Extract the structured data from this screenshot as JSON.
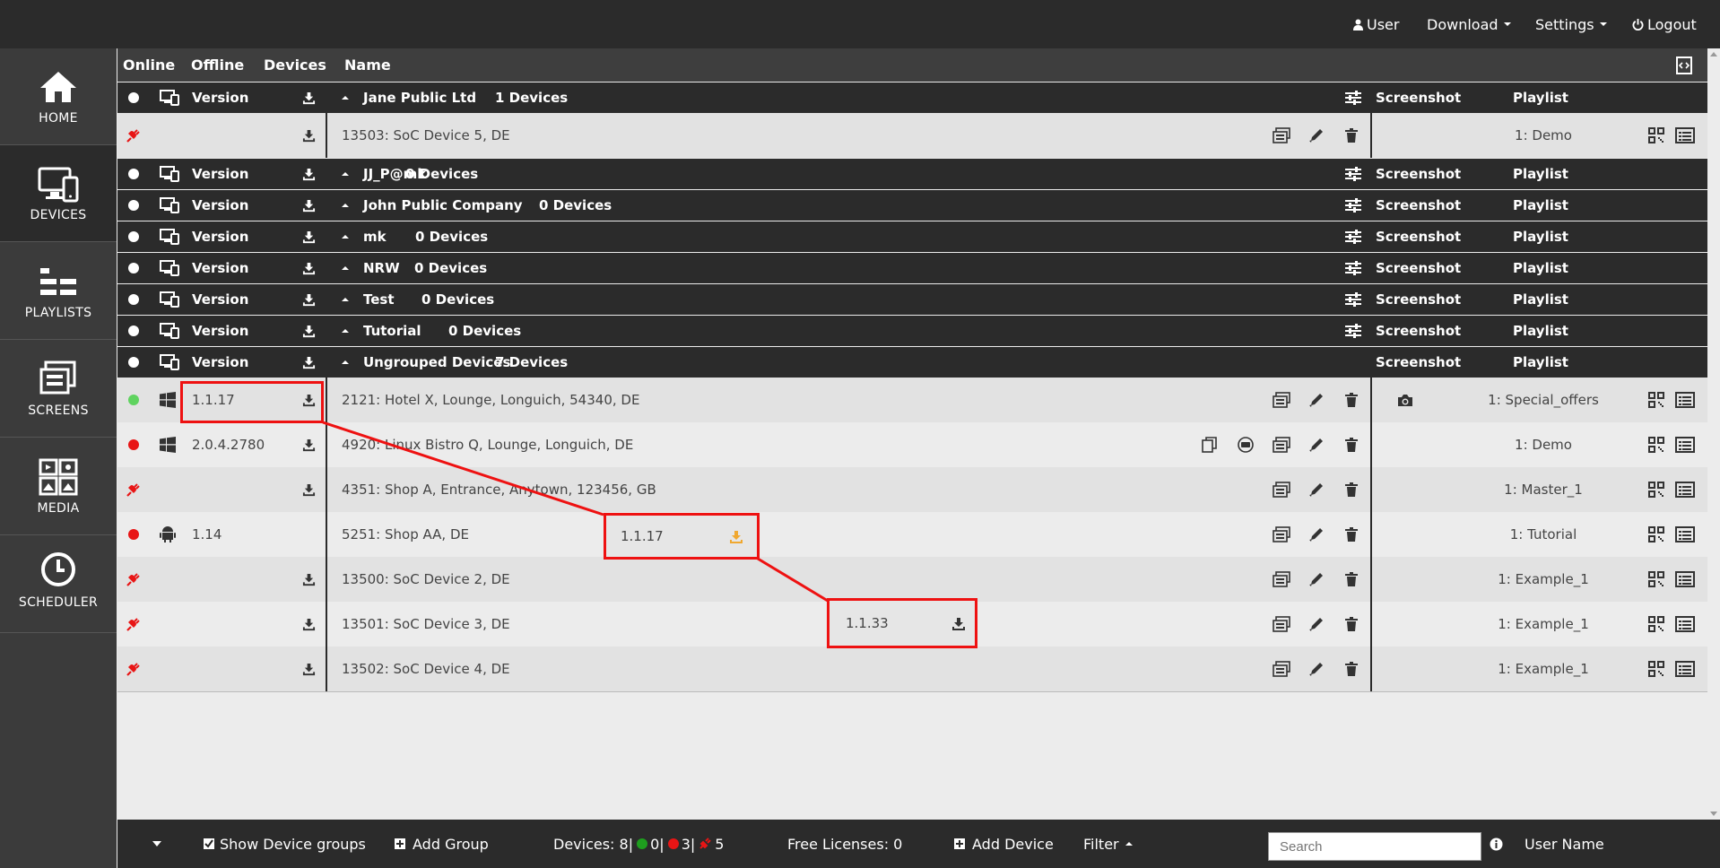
{
  "topbar": {
    "user": "User",
    "download": "Download",
    "settings": "Settings",
    "logout": "Logout"
  },
  "sidebar": [
    {
      "label": "HOME",
      "icon": "home-icon"
    },
    {
      "label": "DEVICES",
      "icon": "devices-icon"
    },
    {
      "label": "PLAYLISTS",
      "icon": "playlists-icon"
    },
    {
      "label": "SCREENS",
      "icon": "screens-icon"
    },
    {
      "label": "MEDIA",
      "icon": "media-icon"
    },
    {
      "label": "SCHEDULER",
      "icon": "clock-icon"
    }
  ],
  "columns": {
    "online": "Online",
    "offline": "Offline",
    "devices": "Devices",
    "name": "Name"
  },
  "group_labels": {
    "version": "Version",
    "screenshot": "Screenshot",
    "playlist": "Playlist"
  },
  "groups": [
    {
      "name": "Jane Public Ltd",
      "count": "1 Devices"
    },
    {
      "name": "JJ_P@mk",
      "count": "0 Devices"
    },
    {
      "name": "John Public Company",
      "count": "0 Devices"
    },
    {
      "name": "mk",
      "count": "0 Devices"
    },
    {
      "name": "NRW",
      "count": "0 Devices"
    },
    {
      "name": "Test",
      "count": "0 Devices"
    },
    {
      "name": "Tutorial",
      "count": "0 Devices"
    },
    {
      "name": "Ungrouped Devices",
      "count": "7 Devices"
    }
  ],
  "devices": [
    {
      "status": "unplugged",
      "os": "",
      "version": "",
      "name": "13503: SoC Device 5, DE",
      "playlist": "1: Demo"
    },
    {
      "status": "online",
      "os": "windows",
      "version": "1.1.17",
      "name": "2121: Hotel X, Lounge, Longuich, 54340, DE",
      "playlist": "1: Special_offers"
    },
    {
      "status": "offline",
      "os": "windows",
      "version": "2.0.4.2780",
      "name": "4920: Linux Bistro Q, Lounge, Longuich, DE",
      "playlist": "1: Demo"
    },
    {
      "status": "unplugged",
      "os": "",
      "version": "",
      "name": "4351: Shop A, Entrance, Anytown, 123456, GB",
      "playlist": "1: Master_1"
    },
    {
      "status": "offline",
      "os": "android",
      "version": "1.14",
      "name": "5251: Shop AA, DE",
      "playlist": "1: Tutorial"
    },
    {
      "status": "unplugged",
      "os": "",
      "version": "",
      "name": "13500: SoC Device 2, DE",
      "playlist": "1: Example_1"
    },
    {
      "status": "unplugged",
      "os": "",
      "version": "",
      "name": "13501: SoC Device 3, DE",
      "playlist": "1: Example_1"
    },
    {
      "status": "unplugged",
      "os": "",
      "version": "",
      "name": "13502: SoC Device 4, DE",
      "playlist": "1: Example_1"
    }
  ],
  "popups": {
    "android_update": "1.1.17",
    "soc_update": "1.1.33"
  },
  "bottombar": {
    "show_groups": "Show Device groups",
    "add_group": "Add Group",
    "devices_label": "Devices: 8|",
    "online_count": "0|",
    "offline_count": "3|",
    "unplugged_count": "5",
    "free_licenses": "Free Licenses: 0",
    "add_device": "Add Device",
    "filter": "Filter",
    "search_placeholder": "Search",
    "username": "User Name"
  },
  "colors": {
    "online": "#5fd35f",
    "offline": "#e81515",
    "unplugged": "#e81515",
    "highlight": "#ee1111",
    "update": "#f0a830"
  }
}
